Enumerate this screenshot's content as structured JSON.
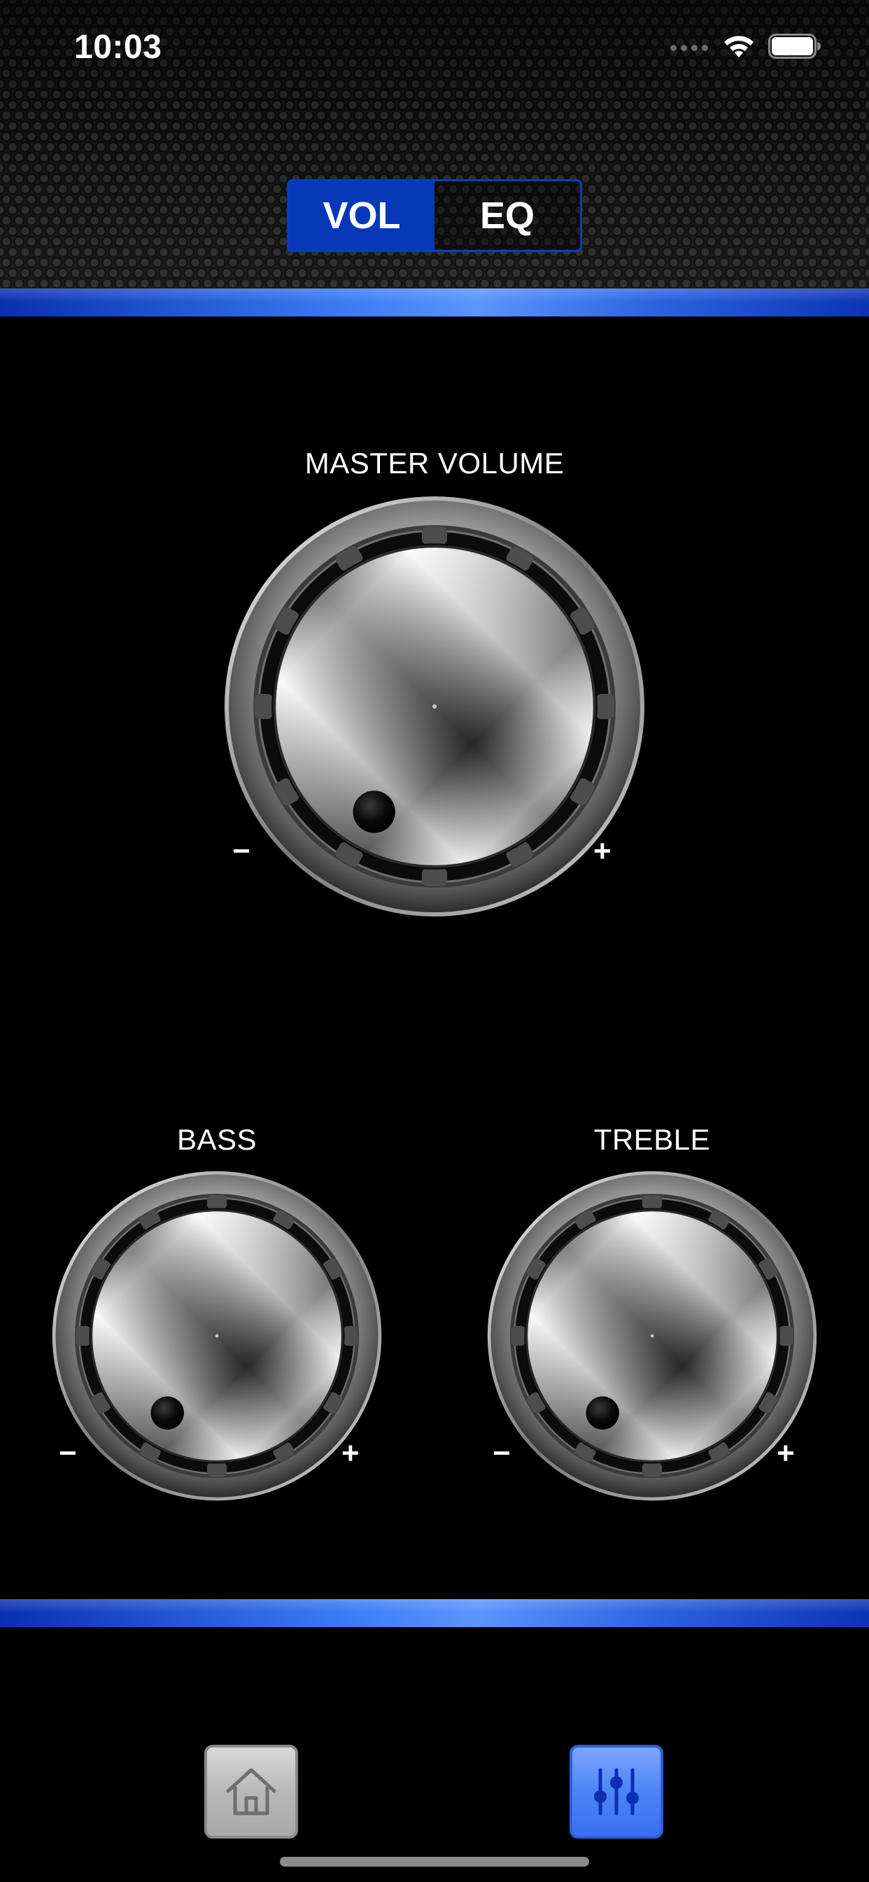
{
  "status_bar": {
    "time": "10:03"
  },
  "tabs": {
    "items": [
      {
        "label": "VOL",
        "active": true
      },
      {
        "label": "EQ",
        "active": false
      }
    ]
  },
  "knobs": {
    "master": {
      "label": "MASTER VOLUME",
      "minus": "−",
      "plus": "+"
    },
    "bass": {
      "label": "BASS",
      "minus": "−",
      "plus": "+"
    },
    "treble": {
      "label": "TREBLE",
      "minus": "−",
      "plus": "+"
    }
  },
  "nav": {
    "home_icon": "home-icon",
    "eq_icon": "equalizer-sliders-icon",
    "active": "equalizer"
  },
  "colors": {
    "accent_blue": "#0738b8",
    "bar_blue": "#3a7cf5",
    "background": "#000000"
  }
}
